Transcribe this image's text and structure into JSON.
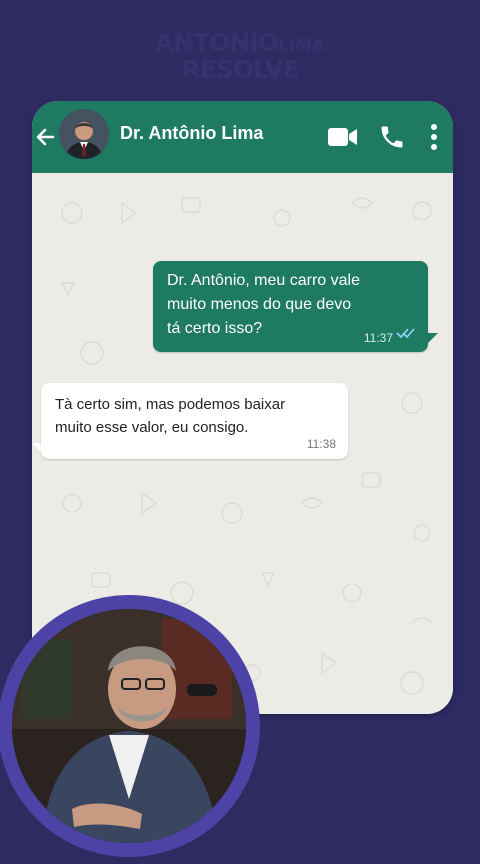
{
  "brand": {
    "line1_main": "ANTONIO",
    "line1_small": "LIMA",
    "line2": "RESOLVE"
  },
  "header": {
    "contact_name": "Dr. Antônio Lima"
  },
  "icons": {
    "back": "back-arrow-icon",
    "video": "video-call-icon",
    "phone": "phone-call-icon",
    "menu": "more-vertical-icon"
  },
  "messages": [
    {
      "direction": "outgoing",
      "text": "Dr. Antônio, meu carro vale\nmuito menos do que devo\ntá certo isso?",
      "time": "11:37",
      "status": "read"
    },
    {
      "direction": "incoming",
      "text": "Tà certo sim, mas podemos baixar\nmuito esse valor, eu consigo.",
      "time": "11:38"
    }
  ],
  "colors": {
    "background": "#2e2b63",
    "whatsapp_green": "#1f7a62",
    "ring": "#4d43a6",
    "read_ticks": "#8fd6ff"
  }
}
